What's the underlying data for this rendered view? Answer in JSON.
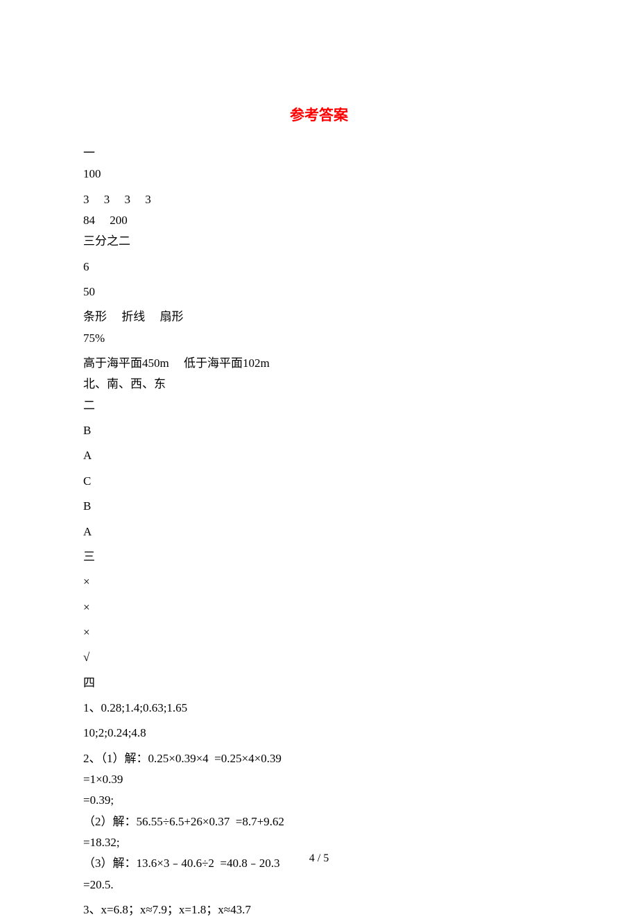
{
  "title": "参考答案",
  "lines": [
    {
      "text": "一",
      "spaced": false
    },
    {
      "text": "100",
      "spaced": true
    },
    {
      "text": "3     3     3     3",
      "spaced": false
    },
    {
      "text": "84     200",
      "spaced": false
    },
    {
      "text": "三分之二",
      "spaced": true
    },
    {
      "text": "6",
      "spaced": true
    },
    {
      "text": "50",
      "spaced": true
    },
    {
      "text": "条形     折线     扇形",
      "spaced": false
    },
    {
      "text": "75%",
      "spaced": true
    },
    {
      "text": "高于海平面450m     低于海平面102m",
      "spaced": false
    },
    {
      "text": "北、南、西、东",
      "spaced": false
    },
    {
      "text": "二",
      "spaced": true
    },
    {
      "text": "B",
      "spaced": true
    },
    {
      "text": "A",
      "spaced": true
    },
    {
      "text": "C",
      "spaced": true
    },
    {
      "text": "B",
      "spaced": true
    },
    {
      "text": "A",
      "spaced": true
    },
    {
      "text": "三",
      "spaced": true
    },
    {
      "text": "×",
      "spaced": true
    },
    {
      "text": "×",
      "spaced": true
    },
    {
      "text": "×",
      "spaced": true
    },
    {
      "text": "√",
      "spaced": true
    },
    {
      "text": "四",
      "spaced": true
    },
    {
      "text": "1、0.28;1.4;0.63;1.65",
      "spaced": true
    },
    {
      "text": "10;2;0.24;4.8",
      "spaced": true
    },
    {
      "text": "2、（1）解：0.25×0.39×4  =0.25×4×0.39",
      "spaced": false
    },
    {
      "text": "=1×0.39",
      "spaced": false
    },
    {
      "text": "=0.39;",
      "spaced": false
    },
    {
      "text": "（2）解：56.55÷6.5+26×0.37  =8.7+9.62",
      "spaced": false
    },
    {
      "text": "=18.32;",
      "spaced": false
    },
    {
      "text": "（3）解：13.6×3﹣40.6÷2  =40.8﹣20.3",
      "spaced": false
    },
    {
      "text": "=20.5.",
      "spaced": true
    },
    {
      "text": "3、x=6.8；x≈7.9；x=1.8；x≈43.7",
      "spaced": false
    }
  ],
  "pageNum": "4 / 5"
}
